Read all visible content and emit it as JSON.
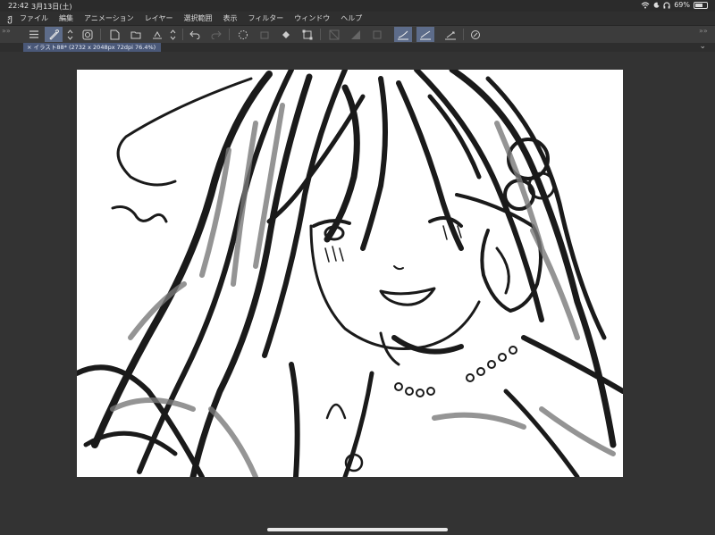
{
  "status_bar": {
    "time": "22:42",
    "date": "3月13日(土)",
    "battery_percent": "69%",
    "battery_level": 0.69,
    "icons": [
      "wifi-icon",
      "do-not-disturb-icon",
      "headphones-icon",
      "battery-icon"
    ]
  },
  "menu": {
    "app_icon": "clip-studio-icon",
    "items": [
      "ファイル",
      "編集",
      "アニメーション",
      "レイヤー",
      "選択範囲",
      "表示",
      "フィルター",
      "ウィンドウ",
      "ヘルプ"
    ]
  },
  "toolbar": {
    "buttons": [
      "menu-icon",
      "tool-icon",
      "updown-icon",
      "layer-icon",
      "new-file-icon",
      "open-icon",
      "save-icon",
      "updown-icon",
      "undo-icon",
      "redo-icon",
      "lasso-icon",
      "clear-icon",
      "fill-icon",
      "transform-icon",
      "mask-icon",
      "gradient-icon",
      "frame-icon",
      "pen-pressure-icon",
      "pen-stroke-icon",
      "ruler-pen-icon",
      "assist-icon"
    ]
  },
  "document_tab": {
    "title": "イラスト88* (2732 x 2048px 72dpi 76.4%)"
  },
  "colors": {
    "background": "#333333",
    "toolbar": "#3c3c3c",
    "accent": "#5d6c8a",
    "tab": "#4a5878",
    "canvas": "#ffffff"
  }
}
